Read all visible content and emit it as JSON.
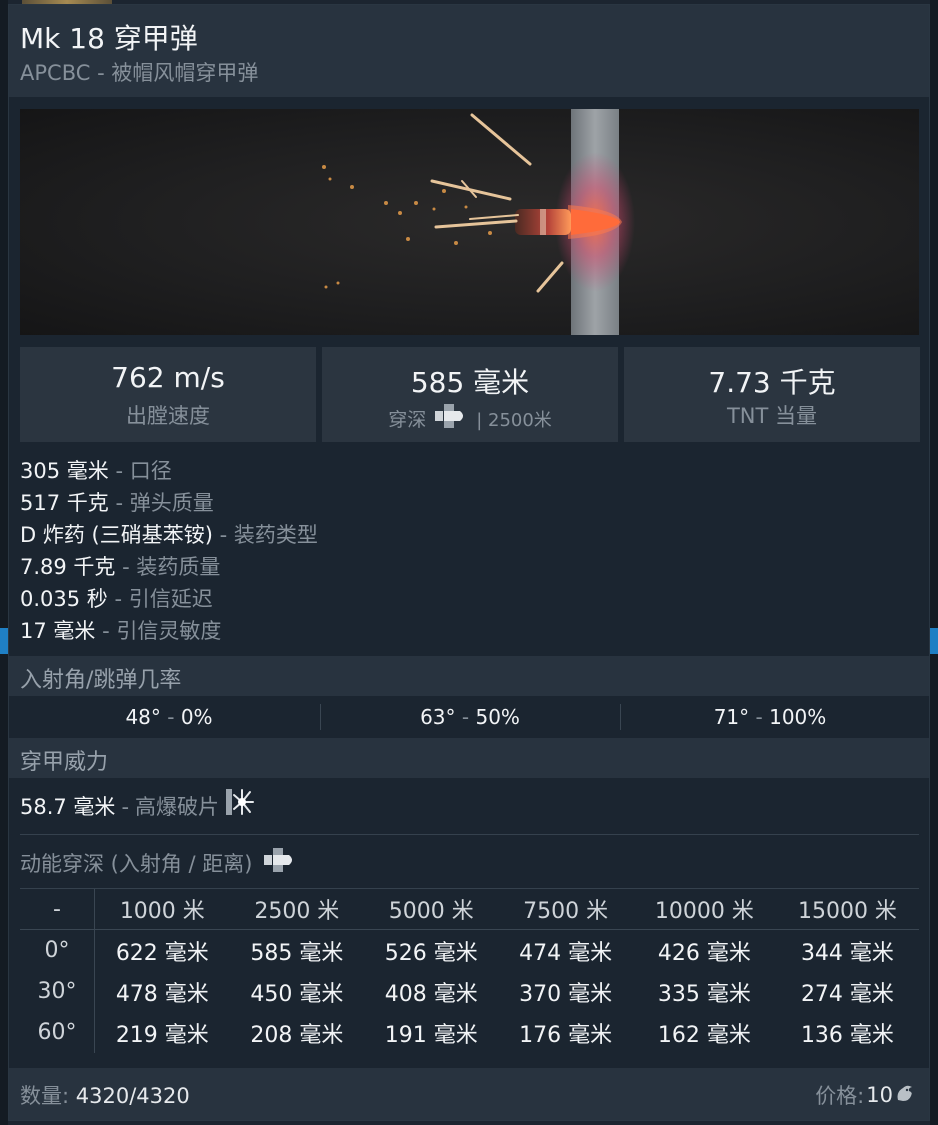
{
  "header": {
    "title": "Mk 18 穿甲弹",
    "subtitle": "APCBC - 被帽风帽穿甲弹"
  },
  "stats": {
    "velocity_value": "762 m/s",
    "velocity_label": "出膛速度",
    "penetration_value": "585 毫米",
    "penetration_label": "穿深",
    "penetration_distance": "2500米",
    "tnt_value": "7.73 千克",
    "tnt_label": "TNT 当量"
  },
  "properties": [
    {
      "value": "305 毫米",
      "label": "口径"
    },
    {
      "value": "517 千克",
      "label": "弹头质量"
    },
    {
      "value": "D 炸药 (三硝基苯铵)",
      "label": "装药类型"
    },
    {
      "value": "7.89 千克",
      "label": "装药质量"
    },
    {
      "value": "0.035 秒",
      "label": "引信延迟"
    },
    {
      "value": "17 毫米",
      "label": "引信灵敏度"
    }
  ],
  "ricochet": {
    "title": "入射角/跳弹几率",
    "items": [
      {
        "angle": "48°",
        "chance": "0%"
      },
      {
        "angle": "63°",
        "chance": "50%"
      },
      {
        "angle": "71°",
        "chance": "100%"
      }
    ]
  },
  "armor_power": {
    "title": "穿甲威力",
    "he_value": "58.7 毫米",
    "he_label": "高爆破片"
  },
  "kinetic": {
    "title": "动能穿深 (入射角 / 距离)",
    "corner": "-",
    "distances": [
      "1000 米",
      "2500 米",
      "5000 米",
      "7500 米",
      "10000 米",
      "15000 米"
    ],
    "rows": [
      {
        "angle": "0°",
        "values": [
          "622 毫米",
          "585 毫米",
          "526 毫米",
          "474 毫米",
          "426 毫米",
          "344 毫米"
        ]
      },
      {
        "angle": "30°",
        "values": [
          "478 毫米",
          "450 毫米",
          "408 毫米",
          "370 毫米",
          "335 毫米",
          "274 毫米"
        ]
      },
      {
        "angle": "60°",
        "values": [
          "219 毫米",
          "208 毫米",
          "191 毫米",
          "176 毫米",
          "162 毫米",
          "136 毫米"
        ]
      }
    ]
  },
  "footer": {
    "quantity_label": "数量:",
    "quantity_value": "4320/4320",
    "price_label": "价格:",
    "price_value": "10"
  },
  "icons": [
    "shell-penetration-icon",
    "he-fragment-icon",
    "kinetic-shell-icon",
    "silver-lions-icon"
  ]
}
